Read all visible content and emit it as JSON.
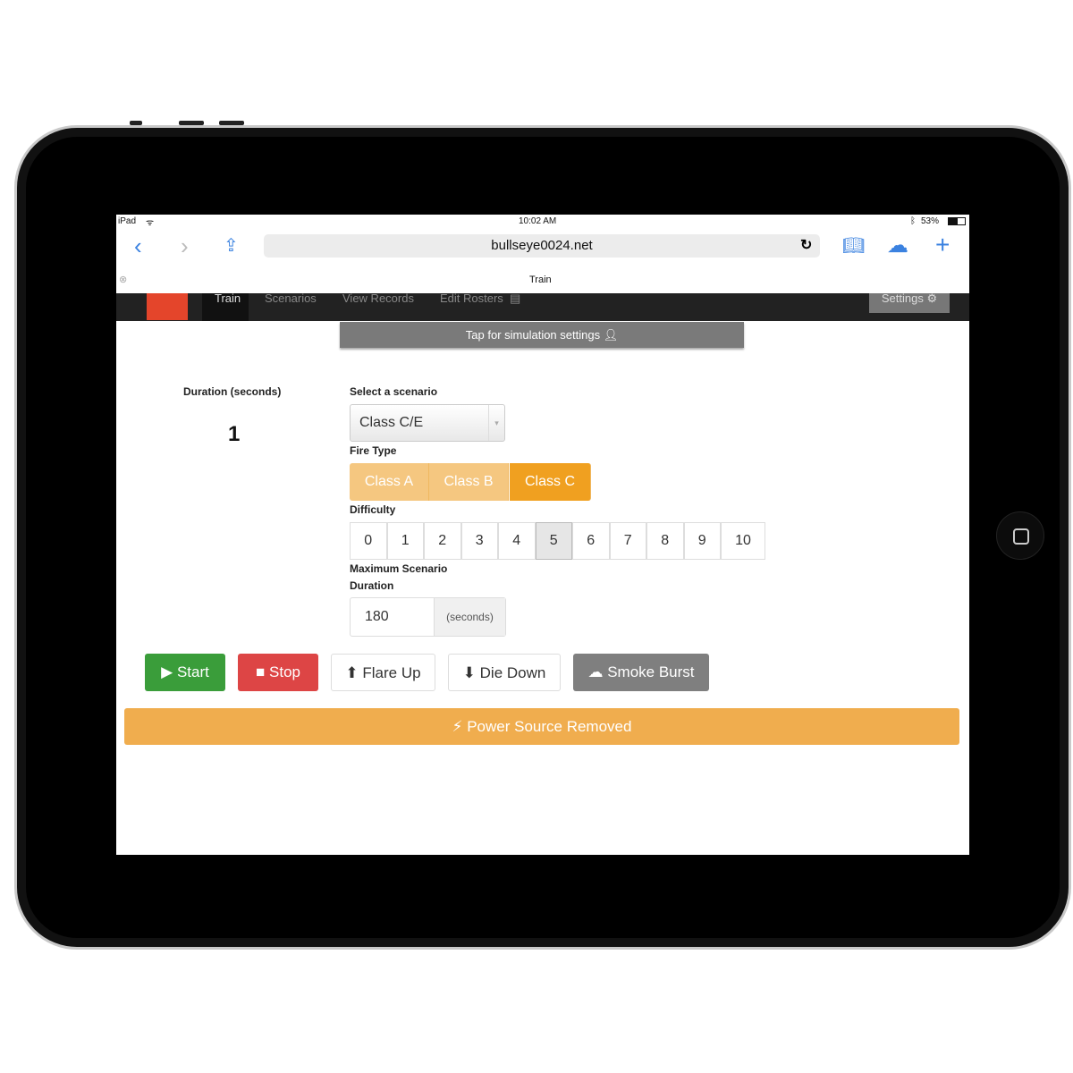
{
  "status": {
    "device": "iPad",
    "time": "10:02 AM",
    "battery": "53%"
  },
  "browser": {
    "url": "bullseye0024.net",
    "tab_title": "Train"
  },
  "nav": {
    "items": [
      "Train",
      "Scenarios",
      "View Records",
      "Edit Rosters"
    ],
    "settings": "Settings"
  },
  "sim_settings": "Tap for simulation settings",
  "duration": {
    "label": "Duration (seconds)",
    "value": "1"
  },
  "scenario": {
    "label": "Select a scenario",
    "value": "Class C/E"
  },
  "fire_type": {
    "label": "Fire Type",
    "options": [
      "Class A",
      "Class B",
      "Class C"
    ],
    "selected": "Class C"
  },
  "difficulty": {
    "label": "Difficulty",
    "options": [
      "0",
      "1",
      "2",
      "3",
      "4",
      "5",
      "6",
      "7",
      "8",
      "9",
      "10"
    ],
    "selected": "5"
  },
  "max_duration": {
    "label1": "Maximum Scenario",
    "label2": "Duration",
    "value": "180",
    "unit": "(seconds)"
  },
  "buttons": {
    "start": "Start",
    "stop": "Stop",
    "flare_up": "Flare Up",
    "die_down": "Die Down",
    "smoke_burst": "Smoke Burst"
  },
  "power": "Power Source Removed",
  "colors": {
    "start": "#3a9d3a",
    "stop": "#dd4545",
    "smoke": "#7f7f7f",
    "warning": "#f0ad4e",
    "selected_fire": "#f0a020"
  }
}
